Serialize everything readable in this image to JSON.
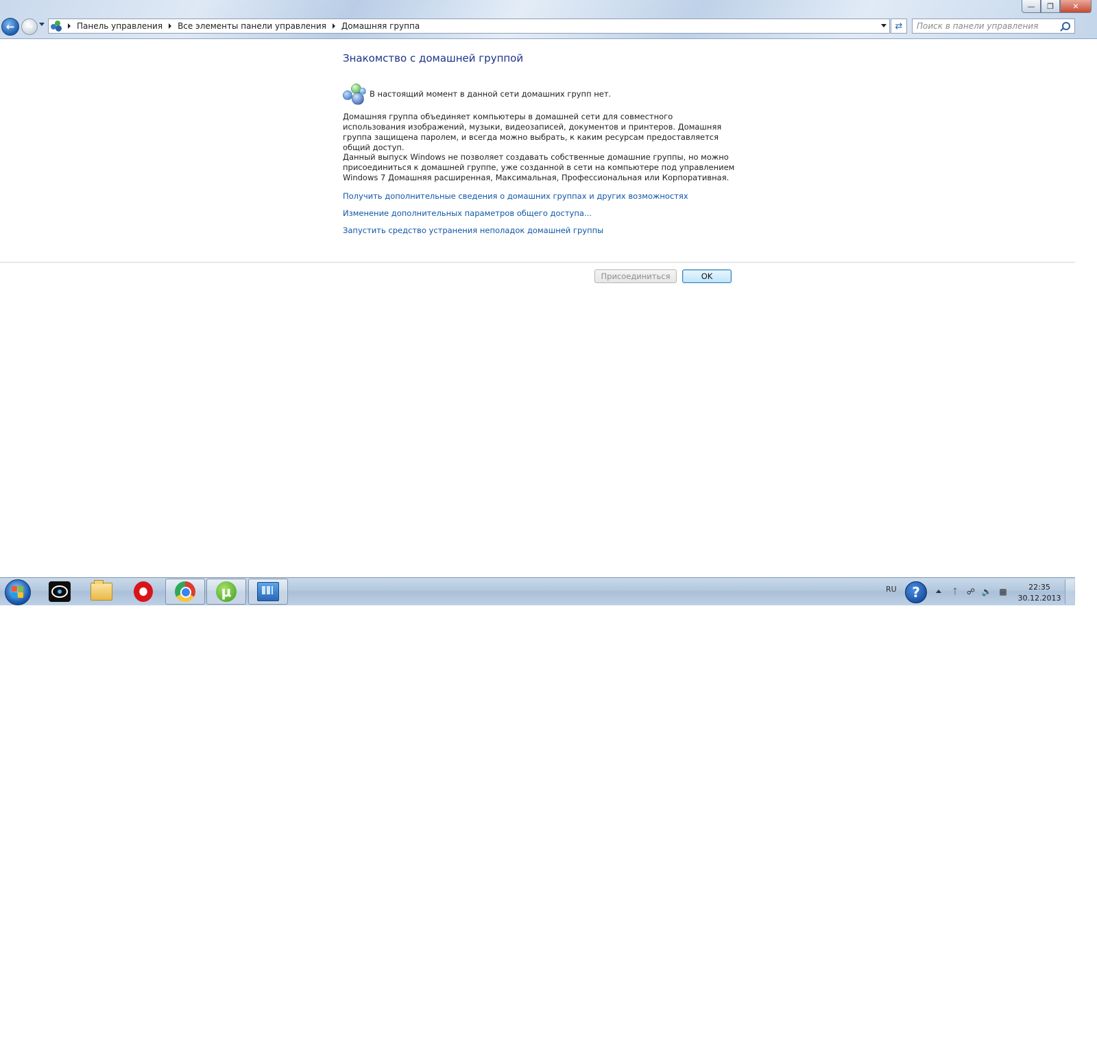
{
  "window": {
    "caption_buttons": [
      "minimize-icon",
      "restore-icon",
      "close-icon"
    ]
  },
  "navigation": {
    "back_icon": "back-arrow-icon",
    "forward_icon": "forward-arrow-icon",
    "breadcrumbs": [
      "Панель управления",
      "Все элементы панели управления",
      "Домашняя группа"
    ],
    "search_placeholder": "Поиск в панели управления"
  },
  "main": {
    "title": "Знакомство с домашней группой",
    "status": "В настоящий момент в данной сети домашних групп нет.",
    "paragraph1": "Домашняя группа объединяет компьютеры в домашней сети для совместного использования изображений, музыки, видеозаписей, документов и принтеров. Домашняя группа защищена паролем, и всегда можно выбрать, к каким ресурсам предоставляется общий доступ.",
    "paragraph2": "Данный выпуск Windows не позволяет создавать собственные домашние группы, но можно присоединиться к домашней группе, уже созданной в сети на компьютере под управлением Windows 7 Домашняя расширенная, Максимальная, Профессиональная или Корпоративная.",
    "links": [
      "Получить дополнительные сведения о домашних группах и других возможностях",
      "Изменение дополнительных параметров общего доступа...",
      "Запустить средство устранения неполадок домашней группы"
    ],
    "buttons": {
      "join": "Присоединиться",
      "ok": "OK"
    }
  },
  "taskbar": {
    "pinned": [
      {
        "name": "media-player-icon",
        "active": false
      },
      {
        "name": "explorer-folder-icon",
        "active": false
      },
      {
        "name": "opera-icon",
        "active": false
      },
      {
        "name": "chrome-icon",
        "active": true
      },
      {
        "name": "utorrent-icon",
        "active": true
      },
      {
        "name": "control-panel-icon",
        "active": true
      }
    ],
    "language": "RU",
    "time": "22:35",
    "date": "30.12.2013"
  }
}
